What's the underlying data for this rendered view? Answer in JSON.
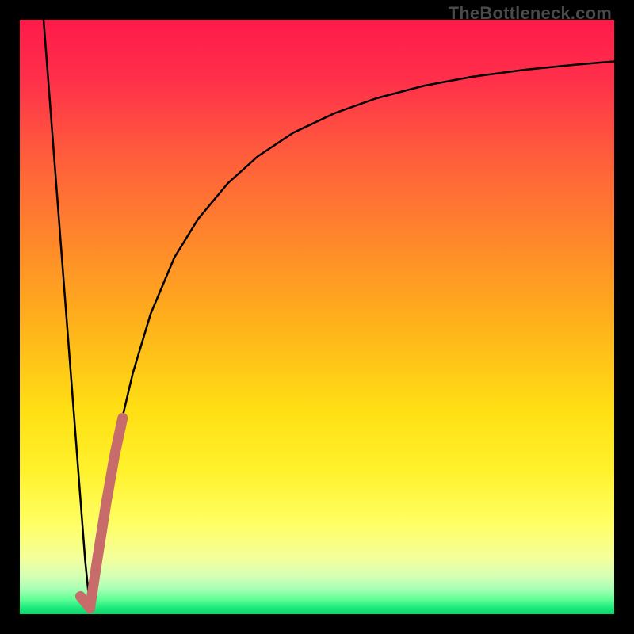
{
  "watermark": "TheBottleneck.com",
  "chart_data": {
    "type": "line",
    "title": "",
    "xlabel": "",
    "ylabel": "",
    "xlim": [
      0,
      100
    ],
    "ylim": [
      0,
      100
    ],
    "grid": false,
    "legend": false,
    "background": {
      "type": "vertical_gradient",
      "stops": [
        {
          "pos": 0.0,
          "color": "#ff1a4a"
        },
        {
          "pos": 0.1,
          "color": "#ff2f4a"
        },
        {
          "pos": 0.22,
          "color": "#ff5a3d"
        },
        {
          "pos": 0.38,
          "color": "#ff8a2a"
        },
        {
          "pos": 0.52,
          "color": "#ffb41a"
        },
        {
          "pos": 0.66,
          "color": "#ffe014"
        },
        {
          "pos": 0.76,
          "color": "#fff22c"
        },
        {
          "pos": 0.85,
          "color": "#ffff66"
        },
        {
          "pos": 0.905,
          "color": "#f4ff9a"
        },
        {
          "pos": 0.935,
          "color": "#d6ffb4"
        },
        {
          "pos": 0.958,
          "color": "#a6ffb4"
        },
        {
          "pos": 0.975,
          "color": "#5fff96"
        },
        {
          "pos": 0.99,
          "color": "#19e87a"
        },
        {
          "pos": 1.0,
          "color": "#0fd66e"
        }
      ]
    },
    "series": [
      {
        "name": "bottleneck_curve_left",
        "color": "#000000",
        "width": 2.5,
        "x": [
          4.0,
          5.0,
          6.0,
          7.0,
          8.0,
          9.0,
          10.0,
          11.0,
          11.8
        ],
        "y": [
          100.0,
          87.0,
          74.0,
          61.0,
          48.0,
          35.0,
          22.0,
          9.0,
          1.0
        ]
      },
      {
        "name": "bottleneck_curve_right",
        "color": "#000000",
        "width": 2.5,
        "x": [
          11.8,
          13.0,
          15.0,
          17.0,
          19.0,
          22.0,
          26.0,
          30.0,
          35.0,
          40.0,
          46.0,
          53.0,
          60.0,
          68.0,
          76.0,
          85.0,
          93.0,
          100.0
        ],
        "y": [
          1.0,
          9.0,
          21.5,
          32.0,
          40.5,
          50.5,
          60.0,
          66.5,
          72.5,
          77.0,
          81.0,
          84.3,
          86.8,
          88.9,
          90.4,
          91.6,
          92.4,
          93.0
        ]
      },
      {
        "name": "highlight_segment",
        "color": "#c76b6b",
        "width": 13,
        "linecap": "round",
        "x": [
          10.2,
          11.8,
          13.0,
          14.5,
          16.0,
          17.3
        ],
        "y": [
          3.0,
          1.0,
          9.0,
          18.5,
          27.0,
          33.0
        ]
      }
    ]
  }
}
